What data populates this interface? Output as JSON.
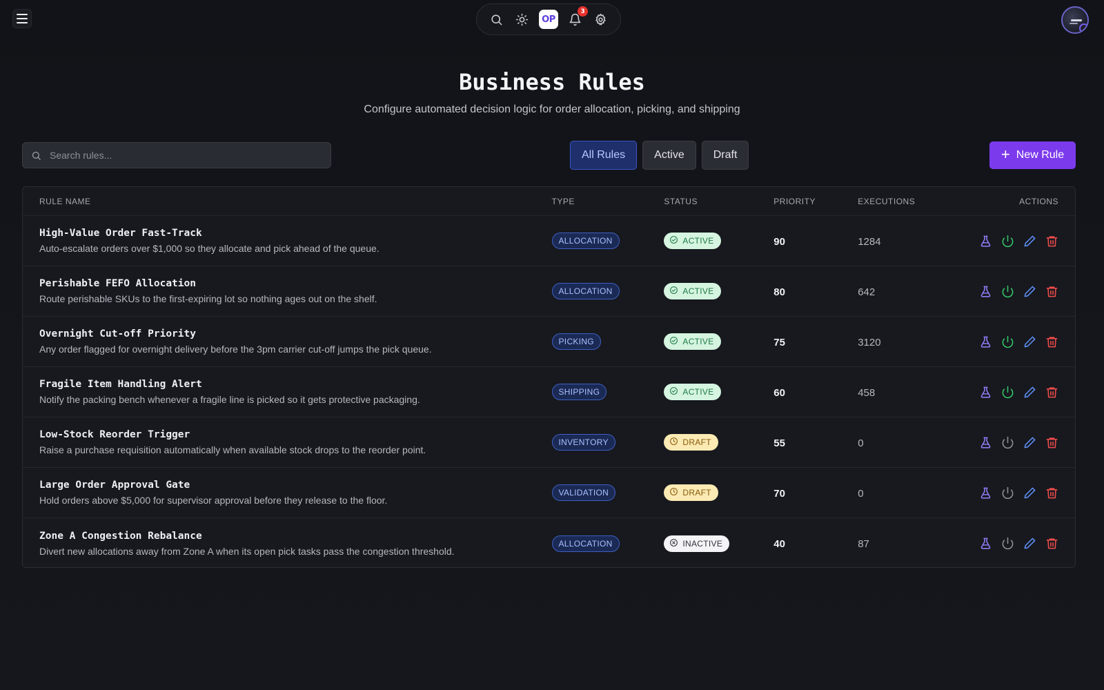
{
  "topbar": {
    "logo_text": "OP",
    "notification_count": "3",
    "icons": [
      "menu-icon",
      "search-icon",
      "sun-icon",
      "bell-icon",
      "gear-icon"
    ]
  },
  "header": {
    "title": "Business Rules",
    "subtitle": "Configure automated decision logic for order allocation, picking, and shipping"
  },
  "toolbar": {
    "search_placeholder": "Search rules...",
    "filters": [
      {
        "label": "All Rules",
        "active": true
      },
      {
        "label": "Active",
        "active": false
      },
      {
        "label": "Draft",
        "active": false
      }
    ],
    "new_rule_label": "New Rule"
  },
  "table": {
    "columns": {
      "name": "RULE NAME",
      "type": "TYPE",
      "status": "STATUS",
      "priority": "PRIORITY",
      "executions": "EXECUTIONS",
      "actions": "ACTIONS"
    },
    "rows": [
      {
        "name": "High-Value Order Fast-Track",
        "description": "Auto-escalate orders over $1,000 so they allocate and pick ahead of the queue.",
        "type": "ALLOCATION",
        "status": "ACTIVE",
        "status_kind": "active",
        "priority": "90",
        "executions": "1284"
      },
      {
        "name": "Perishable FEFO Allocation",
        "description": "Route perishable SKUs to the first-expiring lot so nothing ages out on the shelf.",
        "type": "ALLOCATION",
        "status": "ACTIVE",
        "status_kind": "active",
        "priority": "80",
        "executions": "642"
      },
      {
        "name": "Overnight Cut-off Priority",
        "description": "Any order flagged for overnight delivery before the 3pm carrier cut-off jumps the pick queue.",
        "type": "PICKING",
        "status": "ACTIVE",
        "status_kind": "active",
        "priority": "75",
        "executions": "3120"
      },
      {
        "name": "Fragile Item Handling Alert",
        "description": "Notify the packing bench whenever a fragile line is picked so it gets protective packaging.",
        "type": "SHIPPING",
        "status": "ACTIVE",
        "status_kind": "active",
        "priority": "60",
        "executions": "458"
      },
      {
        "name": "Low-Stock Reorder Trigger",
        "description": "Raise a purchase requisition automatically when available stock drops to the reorder point.",
        "type": "INVENTORY",
        "status": "DRAFT",
        "status_kind": "draft",
        "priority": "55",
        "executions": "0"
      },
      {
        "name": "Large Order Approval Gate",
        "description": "Hold orders above $5,000 for supervisor approval before they release to the floor.",
        "type": "VALIDATION",
        "status": "DRAFT",
        "status_kind": "draft",
        "priority": "70",
        "executions": "0"
      },
      {
        "name": "Zone A Congestion Rebalance",
        "description": "Divert new allocations away from Zone A when its open pick tasks pass the congestion threshold.",
        "type": "ALLOCATION",
        "status": "INACTIVE",
        "status_kind": "inactive",
        "priority": "40",
        "executions": "87"
      }
    ],
    "row_action_icons": [
      "flask-icon",
      "power-icon",
      "pencil-icon",
      "trash-icon"
    ]
  },
  "colors": {
    "accent": "#7c3aed",
    "active_filter": "#1e2f6b",
    "status_active": "#d5f5e0",
    "status_draft": "#fbeab3",
    "status_inactive": "#f4f4f6"
  }
}
